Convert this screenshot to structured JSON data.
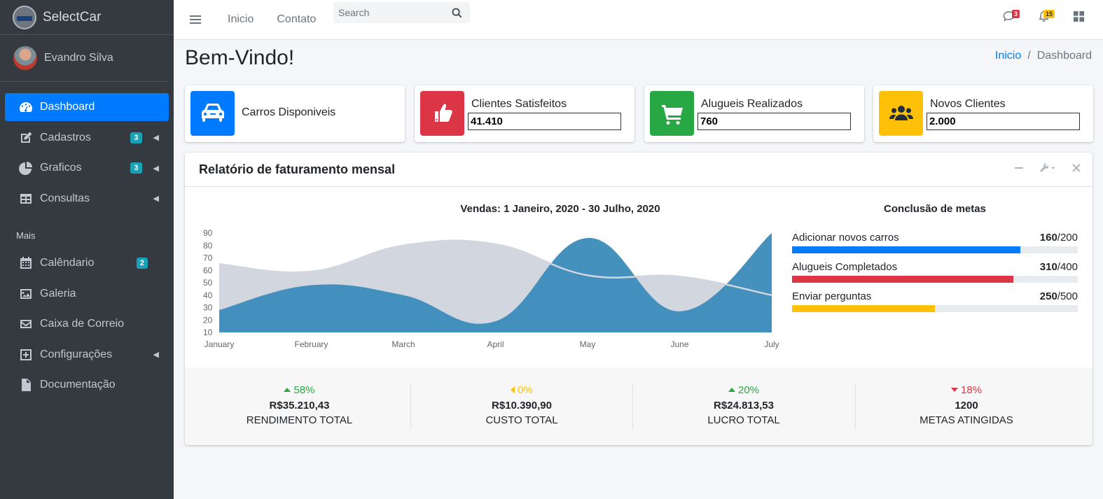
{
  "brand": {
    "name": "SelectCar"
  },
  "user": {
    "name": "Evandro Silva"
  },
  "sidebar": {
    "items": [
      {
        "label": "Dashboard",
        "icon": "tachometer-icon",
        "active": true
      },
      {
        "label": "Cadastros",
        "icon": "edit-icon",
        "badge": "3",
        "arrow": true
      },
      {
        "label": "Graficos",
        "icon": "pie-chart-icon",
        "badge": "3",
        "arrow": true
      },
      {
        "label": "Consultas",
        "icon": "table-icon",
        "arrow": true
      }
    ],
    "section_header": "Mais",
    "more_items": [
      {
        "label": "Calêndario",
        "icon": "calendar-icon",
        "badge": "2"
      },
      {
        "label": "Galeria",
        "icon": "image-icon"
      },
      {
        "label": "Caixa de Correio",
        "icon": "envelope-icon"
      },
      {
        "label": "Configurações",
        "icon": "plus-square-icon",
        "arrow": true
      },
      {
        "label": "Documentação",
        "icon": "file-icon"
      }
    ]
  },
  "topbar": {
    "links": [
      "Inicio",
      "Contato"
    ],
    "search_placeholder": "Search",
    "messages_badge": "3",
    "notifications_badge": "15"
  },
  "page": {
    "title": "Bem-Vindo!",
    "breadcrumb": {
      "home": "Inicio",
      "current": "Dashboard",
      "separator": "/"
    }
  },
  "info_boxes": [
    {
      "label": "Carros Disponiveis",
      "icon": "car-icon",
      "color": "#007bff"
    },
    {
      "label": "Clientes Satisfeitos",
      "value": "41.410",
      "icon": "thumbs-up-icon",
      "color": "#dc3545"
    },
    {
      "label": "Alugueis Realizados",
      "value": "760",
      "icon": "shopping-cart-icon",
      "color": "#28a745"
    },
    {
      "label": "Novos Clientes",
      "value": "2.000",
      "icon": "users-icon",
      "color": "#ffc107"
    }
  ],
  "report": {
    "title": "Relatório de faturamento mensal",
    "chart_title": "Vendas: 1 Janeiro, 2020 - 30 Julho, 2020",
    "goals_title": "Conclusão de metas",
    "goals": [
      {
        "label": "Adicionar novos carros",
        "value": "160",
        "total": "/200",
        "percent": 80,
        "color": "#007bff"
      },
      {
        "label": "Alugueis Completados",
        "value": "310",
        "total": "/400",
        "percent": 77.5,
        "color": "#dc3545"
      },
      {
        "label": "Enviar perguntas",
        "value": "250",
        "total": "/500",
        "percent": 50,
        "color": "#ffc107"
      }
    ],
    "stats": [
      {
        "percent": "58%",
        "trend": "up",
        "color": "#28a745",
        "amount": "R$35.210,43",
        "label": "Rendimento Total"
      },
      {
        "percent": "0%",
        "trend": "left",
        "color": "#ffc107",
        "amount": "R$10.390,90",
        "label": "Custo Total"
      },
      {
        "percent": "20%",
        "trend": "up",
        "color": "#28a745",
        "amount": "R$24.813,53",
        "label": "Lucro Total"
      },
      {
        "percent": "18%",
        "trend": "down",
        "color": "#dc3545",
        "amount": "1200",
        "label": "Metas Atingidas"
      }
    ]
  },
  "chart_data": {
    "type": "area",
    "title": "Vendas: 1 Janeiro, 2020 - 30 Julho, 2020",
    "categories": [
      "January",
      "February",
      "March",
      "April",
      "May",
      "June",
      "July"
    ],
    "ylim": [
      10,
      90
    ],
    "yticks": [
      10,
      20,
      30,
      40,
      50,
      60,
      70,
      80,
      90
    ],
    "series": [
      {
        "values": [
          28,
          48,
          40,
          19,
          86,
          27,
          90
        ],
        "color": "#3b8bba"
      },
      {
        "values": [
          65,
          59,
          80,
          81,
          56,
          55,
          40
        ],
        "color": "#d2d6de"
      }
    ],
    "grid": false,
    "legend": "none"
  }
}
